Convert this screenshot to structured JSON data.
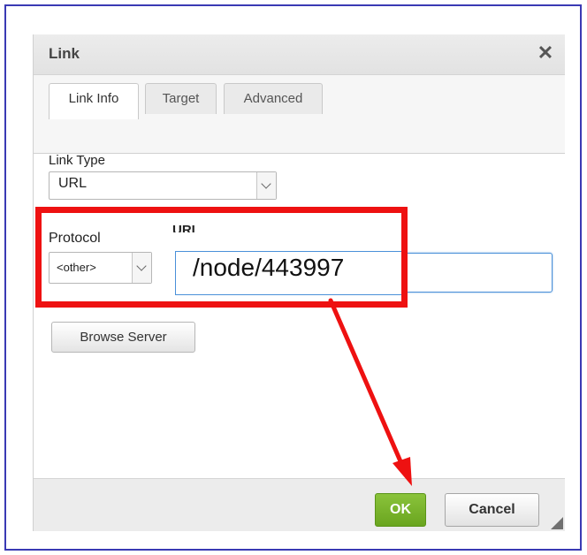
{
  "dialog": {
    "title": "Link",
    "close_glyph": "✕",
    "tabs": [
      {
        "label": "Link Info",
        "active": true
      },
      {
        "label": "Target",
        "active": false
      },
      {
        "label": "Advanced",
        "active": false
      }
    ]
  },
  "link_info": {
    "link_type_label": "Link Type",
    "link_type_value": "URL",
    "protocol_label": "Protocol",
    "protocol_value": "<other>",
    "url_label": "URL",
    "url_value": "/node/443997",
    "browse_button_label": "Browse Server"
  },
  "footer": {
    "ok_label": "OK",
    "cancel_label": "Cancel"
  },
  "icons": {
    "close": "close-icon",
    "dropdown": "chevron-down-icon",
    "resize": "resize-grip-icon"
  },
  "colors": {
    "frame_border": "#3a3ab4",
    "annotation_red": "#ee1111",
    "ok_green": "#6aa51f",
    "input_focus_border": "#4a90d9"
  }
}
